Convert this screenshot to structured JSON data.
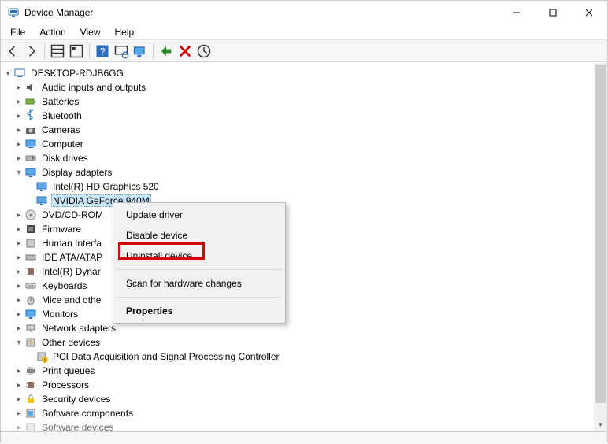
{
  "window": {
    "title": "Device Manager"
  },
  "menu": {
    "file": "File",
    "action": "Action",
    "view": "View",
    "help": "Help"
  },
  "tree": {
    "root": "DESKTOP-RDJB6GG",
    "audio": "Audio inputs and outputs",
    "batteries": "Batteries",
    "bluetooth": "Bluetooth",
    "cameras": "Cameras",
    "computer": "Computer",
    "disk": "Disk drives",
    "display": "Display adapters",
    "display_intel": "Intel(R) HD Graphics 520",
    "display_nvidia": "NVIDIA GeForce 940M",
    "dvd": "DVD/CD-ROM",
    "firmware": "Firmware",
    "hid": "Human Interfa",
    "ide": "IDE ATA/ATAP",
    "ird": "Intel(R) Dynar",
    "keyboards": "Keyboards",
    "mice": "Mice and othe",
    "monitors": "Monitors",
    "network": "Network adapters",
    "other": "Other devices",
    "other_pci": "PCI Data Acquisition and Signal Processing Controller",
    "print": "Print queues",
    "processors": "Processors",
    "security": "Security devices",
    "softcomp": "Software components",
    "softdev": "Software devices"
  },
  "context": {
    "update": "Update driver",
    "disable": "Disable device",
    "uninstall": "Uninstall device",
    "scan": "Scan for hardware changes",
    "properties": "Properties"
  }
}
